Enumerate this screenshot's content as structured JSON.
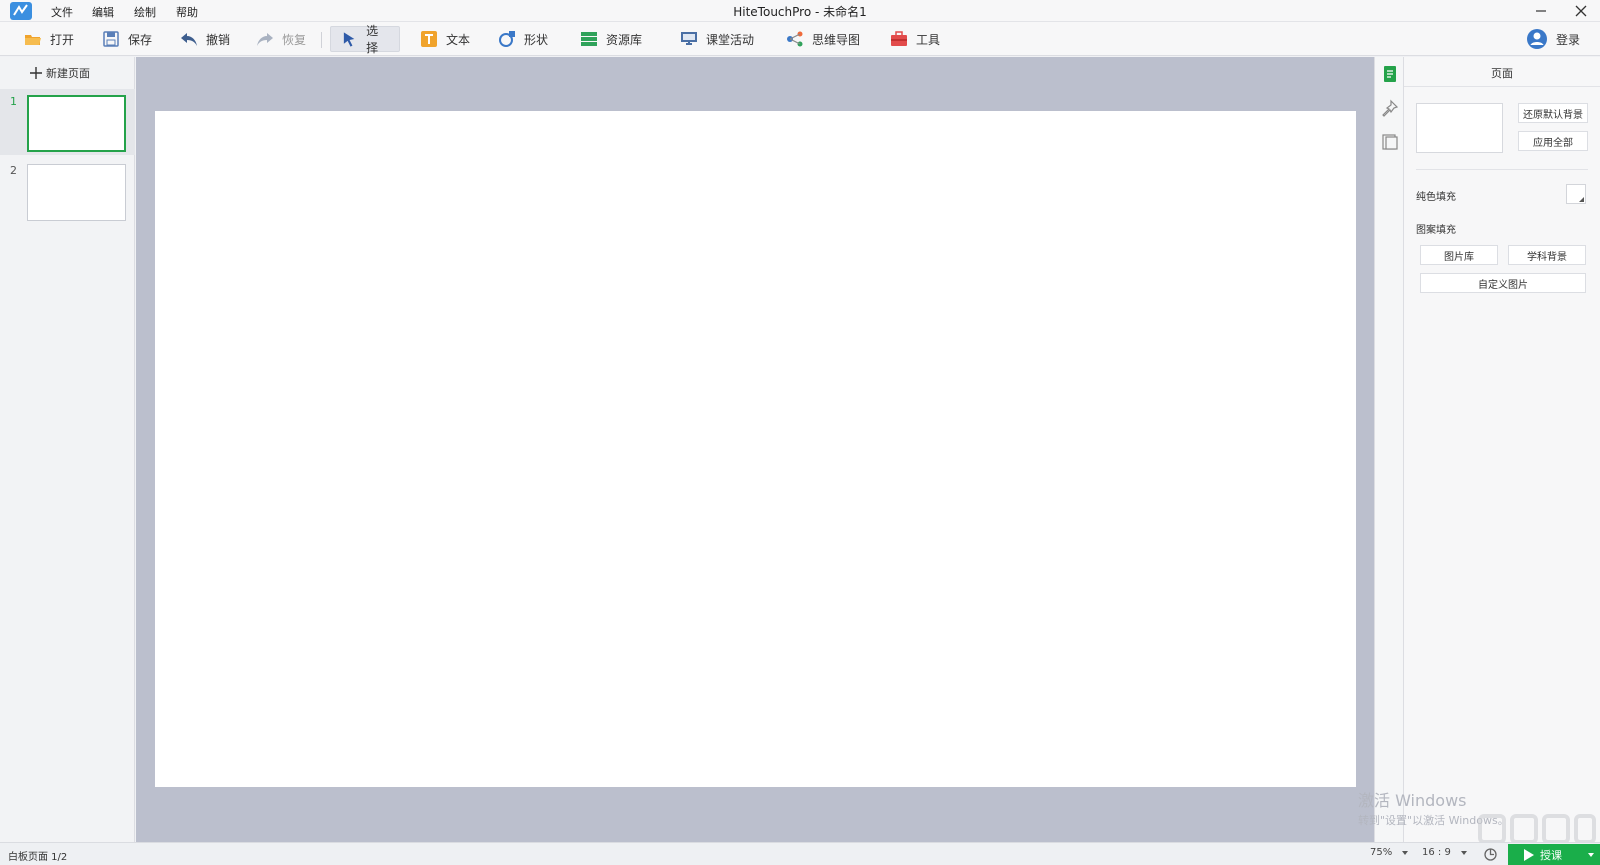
{
  "window": {
    "title": "HiteTouchPro - 未命名1"
  },
  "menu": [
    "文件",
    "编辑",
    "绘制",
    "帮助"
  ],
  "toolbar": {
    "open": "打开",
    "save": "保存",
    "undo": "撤销",
    "redo": "恢复",
    "select": "选择",
    "text": "文本",
    "shape": "形状",
    "resources": "资源库",
    "class_activity": "课堂活动",
    "mind_map": "思维导图",
    "tools": "工具",
    "login": "登录"
  },
  "pages_panel": {
    "new_page": "新建页面",
    "pages": [
      {
        "num": "1",
        "selected": true
      },
      {
        "num": "2",
        "selected": false
      }
    ]
  },
  "props": {
    "title": "页面",
    "restore_bg": "还原默认背景",
    "apply_all": "应用全部",
    "solid_fill": "纯色填充",
    "solid_color": "#ffffff",
    "pattern_fill": "图案填充",
    "gallery": "图片库",
    "subject_bg": "学科背景",
    "custom_image": "自定义图片"
  },
  "status": {
    "page_info": "白板页面 1/2",
    "zoom": "75%",
    "ratio": "16 : 9",
    "teach": "授课"
  },
  "watermark": {
    "line1": "激活 Windows",
    "line2": "转到\"设置\"以激活 Windows。"
  },
  "colors": {
    "accent_green": "#1aae4a",
    "canvas_bg": "#bbbfcd"
  }
}
